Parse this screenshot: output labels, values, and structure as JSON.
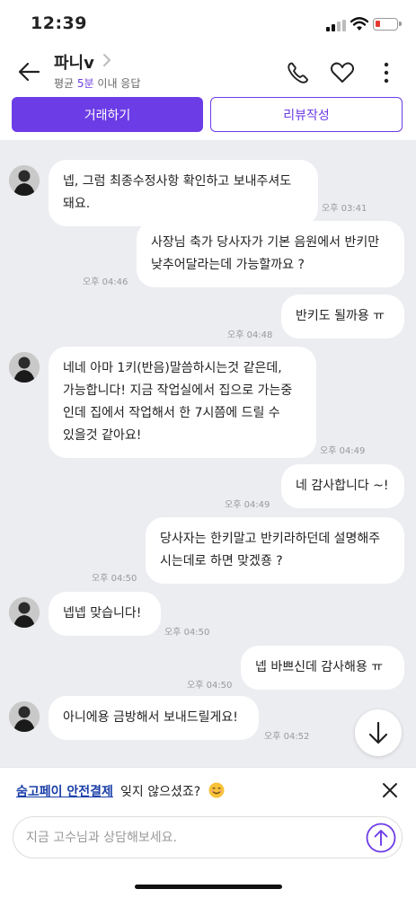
{
  "status": {
    "time": "12:39"
  },
  "header": {
    "name": "파니v",
    "response_prefix": "평균 ",
    "response_highlight": "5분",
    "response_suffix": " 이내 응답"
  },
  "actions": {
    "deal": "거래하기",
    "review": "리뷰작성"
  },
  "messages": [
    {
      "side": "left",
      "lines": [
        "넵, 그럼 최종수정사항 확인하고 보내주셔도",
        "돼요."
      ],
      "time": "오후 03:41"
    },
    {
      "side": "right",
      "lines": [
        "사장님 축가 당사자가 기본 음원에서 반키만",
        "낮추어달라는데 가능할까요 ?"
      ],
      "time": "오후 04:46"
    },
    {
      "side": "right",
      "lines": [
        "반키도 될까용 ㅠ"
      ],
      "time": "오후 04:48"
    },
    {
      "side": "left",
      "lines": [
        "네네 아마 1키(반음)말씀하시는것 같은데,",
        "가능합니다! 지금 작업실에서 집으로 가는중",
        "인데 집에서 작업해서 한 7시쯤에 드릴 수",
        "있을것 같아요!"
      ],
      "time": "오후 04:49"
    },
    {
      "side": "right",
      "lines": [
        "네 감사합니다 ~!"
      ],
      "time": "오후 04:49"
    },
    {
      "side": "right",
      "lines": [
        "당사자는 한키말고 반키라하던데 설명해주",
        "시는데로 하면 맞겠죵 ?"
      ],
      "time": "오후 04:50"
    },
    {
      "side": "left",
      "lines": [
        "넵넵 맞습니다!"
      ],
      "time": "오후 04:50"
    },
    {
      "side": "right",
      "lines": [
        "넵 바쁘신데 감사해용 ㅠ"
      ],
      "time": "오후 04:50"
    },
    {
      "side": "left",
      "lines": [
        "아니에용 금방해서 보내드릴게요!"
      ],
      "time": "오후 04:52"
    }
  ],
  "notice": {
    "link": "숨고페이 안전결제",
    "text": "잊지 않으셨죠?"
  },
  "input": {
    "placeholder": "지금 고수님과 상담해보세요."
  },
  "colors": {
    "accent": "#6c3ce6",
    "chat_bg": "#ecedf1",
    "link": "#1a3ea8"
  }
}
